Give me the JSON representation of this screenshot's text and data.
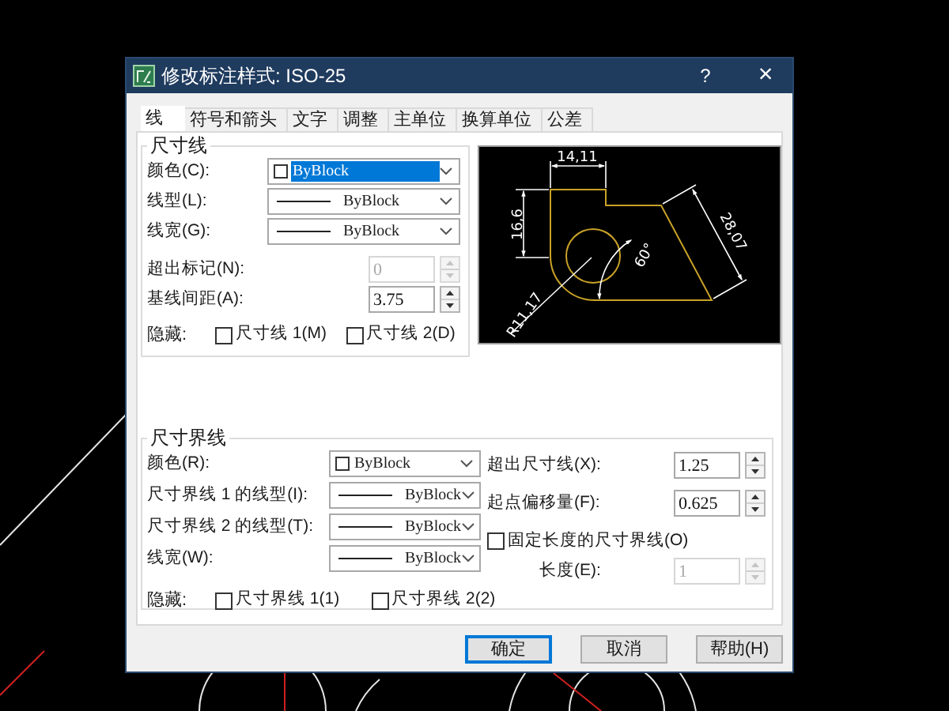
{
  "window": {
    "title": "修改标注样式: ISO-25",
    "help_glyph": "?",
    "close_glyph": "×"
  },
  "tabs": [
    {
      "label": "线",
      "selected": true
    },
    {
      "label": "符号和箭头",
      "selected": false
    },
    {
      "label": "文字",
      "selected": false
    },
    {
      "label": "调整",
      "selected": false
    },
    {
      "label": "主单位",
      "selected": false
    },
    {
      "label": "换算单位",
      "selected": false
    },
    {
      "label": "公差",
      "selected": false
    }
  ],
  "dimension_lines": {
    "title": "尺寸线",
    "fields": [
      {
        "kind": "color_combo",
        "label": "颜色(C):",
        "value": "ByBlock",
        "focused": true
      },
      {
        "kind": "line_combo",
        "label": "线型(L):",
        "value": "ByBlock",
        "focused": false
      },
      {
        "kind": "line_combo",
        "label": "线宽(G):",
        "value": "ByBlock",
        "focused": false
      },
      {
        "kind": "spin",
        "label": "超出标记(N):",
        "value": "0",
        "disabled": true
      },
      {
        "kind": "spin",
        "label": "基线间距(A):",
        "value": "3.75",
        "disabled": false
      }
    ],
    "hide": {
      "label": "隐藏:",
      "options": [
        {
          "label": "尺寸线 1(M)",
          "checked": false
        },
        {
          "label": "尺寸线 2(D)",
          "checked": false
        }
      ]
    }
  },
  "preview": {
    "labels": [
      "14,11",
      "16,6",
      "28,07",
      "60°",
      "R11,17"
    ]
  },
  "extension_lines": {
    "title": "尺寸界线",
    "fields": [
      {
        "kind": "color_combo",
        "label": "颜色(R):",
        "value": "ByBlock",
        "focused": false
      },
      {
        "kind": "line_combo",
        "label": "尺寸界线 1 的线型(I):",
        "value": "ByBlock",
        "focused": false
      },
      {
        "kind": "line_combo",
        "label": "尺寸界线 2 的线型(T):",
        "value": "ByBlock",
        "focused": false
      },
      {
        "kind": "line_combo",
        "label": "线宽(W):",
        "value": "ByBlock",
        "focused": false
      }
    ],
    "right_fields": [
      {
        "kind": "spin",
        "label": "超出尺寸线(X):",
        "value": "1.25",
        "disabled": false
      },
      {
        "kind": "spin",
        "label": "起点偏移量(F):",
        "value": "0.625",
        "disabled": false
      },
      {
        "kind": "checkbox",
        "label": "固定长度的尺寸界线(O)",
        "checked": false
      },
      {
        "kind": "spin",
        "label": "长度(E):",
        "value": "1",
        "disabled": true
      }
    ],
    "hide": {
      "label": "隐藏:",
      "options": [
        {
          "label": "尺寸界线 1(1)",
          "checked": false
        },
        {
          "label": "尺寸界线 2(2)",
          "checked": false
        }
      ]
    }
  },
  "buttons": [
    {
      "label": "确定",
      "default": true
    },
    {
      "label": "取消",
      "default": false
    },
    {
      "label": "帮助(H)",
      "default": false
    }
  ]
}
